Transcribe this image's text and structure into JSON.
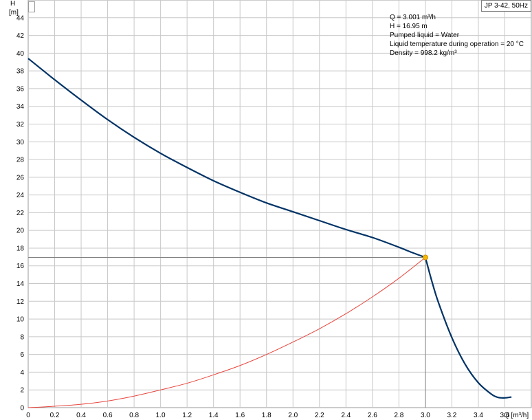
{
  "pump_label": "JP 3-42, 50Hz",
  "info": {
    "flow": "Q = 3.001 m³/h",
    "head": "H = 16.95 m",
    "liquid": "Pumped liquid = Water",
    "temperature": "Liquid temperature during operation = 20 °C",
    "density": "Density = 998.2 kg/m³"
  },
  "colors": {
    "pump_curve": "#003366",
    "system_curve": "#e8453c",
    "grid": "#c8c8c8",
    "guide_lines": "#808080",
    "duty_point": "#f5b800"
  },
  "chart_data": {
    "type": "line",
    "xlabel": "Q [m³/h]",
    "ylabel_top": "H",
    "ylabel_unit": "[m]",
    "xlim": [
      0,
      3.8
    ],
    "ylim": [
      0,
      46
    ],
    "x_ticks": [
      0,
      0.2,
      0.4,
      0.6,
      0.8,
      1.0,
      1.2,
      1.4,
      1.6,
      1.8,
      2.0,
      2.2,
      2.4,
      2.6,
      2.8,
      3.0,
      3.2,
      3.4,
      3.6
    ],
    "x_tick_labels": [
      "0",
      "0.2",
      "0.4",
      "0.6",
      "0.8",
      "1.0",
      "1.2",
      "1.4",
      "1.6",
      "1.8",
      "2.0",
      "2.2",
      "2.4",
      "2.6",
      "2.8",
      "3.0",
      "3.2",
      "3.4",
      "3.6"
    ],
    "y_ticks": [
      0,
      2,
      4,
      6,
      8,
      10,
      12,
      14,
      16,
      18,
      20,
      22,
      24,
      26,
      28,
      30,
      32,
      34,
      36,
      38,
      40,
      42,
      44
    ],
    "grid": true,
    "series": [
      {
        "x": [
          0,
          0.1,
          0.2,
          0.4,
          0.6,
          0.8,
          1.0,
          1.2,
          1.4,
          1.6,
          1.8,
          2.0,
          2.2,
          2.4,
          2.6,
          2.8,
          2.9,
          3.0,
          3.05,
          3.1,
          3.2,
          3.3,
          3.4,
          3.5,
          3.55,
          3.6,
          3.65
        ],
        "y": [
          39.4,
          38.2,
          37.0,
          34.7,
          32.5,
          30.5,
          28.7,
          27.1,
          25.6,
          24.3,
          23.1,
          22.1,
          21.1,
          20.1,
          19.2,
          18.1,
          17.5,
          16.95,
          14.2,
          11.8,
          7.9,
          4.9,
          2.8,
          1.5,
          1.15,
          1.1,
          1.2
        ]
      },
      {
        "x": [
          0,
          0.2,
          0.4,
          0.6,
          0.8,
          1.0,
          1.2,
          1.4,
          1.6,
          1.8,
          2.0,
          2.2,
          2.4,
          2.6,
          2.8,
          3.0
        ],
        "y": [
          0,
          0.16,
          0.38,
          0.75,
          1.3,
          2.0,
          2.75,
          3.7,
          4.75,
          6.0,
          7.4,
          8.9,
          10.6,
          12.5,
          14.6,
          16.95
        ]
      }
    ],
    "duty_point": {
      "x": 3.0,
      "y": 16.95
    }
  }
}
